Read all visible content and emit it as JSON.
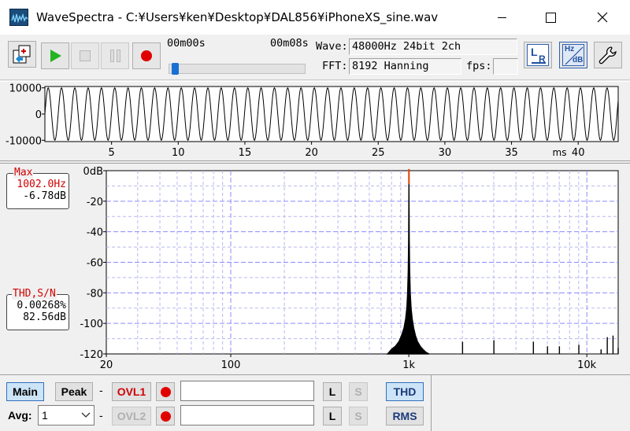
{
  "window": {
    "title": "WaveSpectra - C:¥Users¥ken¥Desktop¥DAL856¥iPhoneXS_sine.wav"
  },
  "toolbar": {
    "time_start": "00m00s",
    "time_end": "00m08s",
    "position_fraction": 0.02,
    "wave_label": "Wave:",
    "wave_value": "48000Hz 24bit 2ch",
    "fft_label": "FFT:",
    "fft_value": "8192 Hanning",
    "fps_label": "fps:",
    "fps_value": "",
    "buttons": [
      "open-file",
      "play",
      "stop",
      "pause",
      "record",
      "channel-lr",
      "hz-db",
      "settings"
    ],
    "lr_icon_text": {
      "l": "L",
      "r": "R"
    },
    "hzdb_icon_text": {
      "hz": "Hz",
      "db": "dB"
    }
  },
  "wave_chart": {
    "type": "line",
    "y_ticks": [
      "10000",
      "0",
      "-10000"
    ],
    "x_ticks": [
      "5",
      "10",
      "15",
      "20",
      "25",
      "30",
      "35",
      "40"
    ],
    "x_unit": "ms",
    "x_range": [
      0,
      43
    ],
    "y_range": [
      -10500,
      10500
    ],
    "signal_frequency_hz": 1002,
    "amplitude": 10000
  },
  "chart_data": {
    "type": "line",
    "xlabel": "",
    "ylabel": "",
    "x_scale": "log",
    "x_range": [
      20,
      15000
    ],
    "y_range": [
      -120,
      0
    ],
    "x_tick_labels": [
      {
        "value": 20,
        "label": "20"
      },
      {
        "value": 100,
        "label": "100"
      },
      {
        "value": 1000,
        "label": "1k"
      },
      {
        "value": 10000,
        "label": "10k"
      }
    ],
    "y_tick_labels": [
      {
        "value": 0,
        "label": "0dB"
      },
      {
        "value": -20,
        "label": "-20"
      },
      {
        "value": -40,
        "label": "-40"
      },
      {
        "value": -60,
        "label": "-60"
      },
      {
        "value": -80,
        "label": "-80"
      },
      {
        "value": -100,
        "label": "-100"
      },
      {
        "value": -120,
        "label": "-120"
      }
    ],
    "grid": true,
    "peak": {
      "freq": 1002,
      "db": -6.78
    },
    "series": [
      {
        "x": [
          760,
          800,
          840,
          880,
          910,
          940,
          960,
          975,
          985,
          993,
          998,
          1002,
          1006,
          1011,
          1019,
          1030,
          1045,
          1065,
          1090,
          1120,
          1160,
          1200,
          1250,
          1300
        ],
        "y": [
          -120,
          -117,
          -115,
          -112,
          -108,
          -103,
          -97,
          -90,
          -80,
          -65,
          -45,
          -6.78,
          -45,
          -65,
          -80,
          -90,
          -97,
          -103,
          -108,
          -112,
          -115,
          -117,
          -119,
          -120
        ]
      }
    ],
    "harmonics": [
      {
        "freq": 2004,
        "db": -112
      },
      {
        "freq": 3006,
        "db": -111
      },
      {
        "freq": 5010,
        "db": -112
      },
      {
        "freq": 6012,
        "db": -115
      },
      {
        "freq": 7014,
        "db": -115
      },
      {
        "freq": 9018,
        "db": -114
      },
      {
        "freq": 12024,
        "db": -117
      },
      {
        "freq": 13026,
        "db": -109
      },
      {
        "freq": 14028,
        "db": -108
      },
      {
        "freq": 15000,
        "db": -116
      }
    ]
  },
  "readouts": {
    "max": {
      "header": "Max",
      "freq": "1002.0Hz",
      "level": "-6.78dB"
    },
    "thd": {
      "header": "THD,S/N",
      "thd": "0.00268%",
      "sn": "82.56dB"
    }
  },
  "bottom": {
    "main": "Main",
    "peak": "Peak",
    "dash": "-",
    "ovl1": "OVL1",
    "ovl2": "OVL2",
    "avg_label": "Avg:",
    "avg_value": "1",
    "l": "L",
    "s": "S",
    "thd": "THD",
    "rms": "RMS",
    "text1": "",
    "text2": ""
  }
}
